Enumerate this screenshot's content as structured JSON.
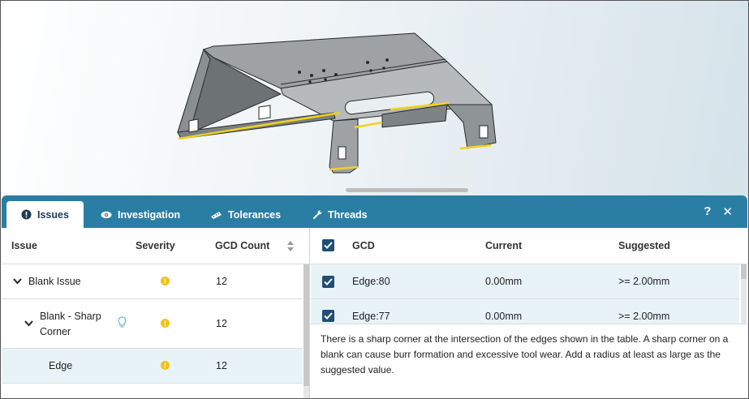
{
  "tabs": [
    {
      "label": "Issues",
      "icon": "info-circle-icon",
      "active": true
    },
    {
      "label": "Investigation",
      "icon": "eye-icon",
      "active": false
    },
    {
      "label": "Tolerances",
      "icon": "ruler-icon",
      "active": false
    },
    {
      "label": "Threads",
      "icon": "wrench-icon",
      "active": false
    }
  ],
  "header_icons": {
    "help": "?",
    "close": "✕"
  },
  "issues_table": {
    "columns": [
      "Issue",
      "Severity",
      "GCD Count"
    ],
    "rows": [
      {
        "label": "Blank Issue",
        "expanded": true,
        "severity": "!",
        "count": "12"
      },
      {
        "label": "Blank - Sharp Corner",
        "expanded": true,
        "severity": "!",
        "count": "12",
        "hint_icon": "lightbulb-icon"
      },
      {
        "label": "Edge",
        "severity": "!",
        "count": "12",
        "selected": true
      }
    ]
  },
  "gcd_table": {
    "columns": [
      "GCD",
      "Current",
      "Suggested"
    ],
    "rows": [
      {
        "gcd": "Edge:80",
        "current": "0.00mm",
        "suggested": ">= 2.00mm",
        "checked": true
      },
      {
        "gcd": "Edge:77",
        "current": "0.00mm",
        "suggested": ">= 2.00mm",
        "checked": true
      }
    ],
    "description": "There is a sharp corner at the intersection of the edges shown in the table. A sharp corner on a blank can cause burr formation and excessive tool wear. Add a radius at least as large as the suggested value."
  },
  "colors": {
    "tab_bar": "#2a7ea4",
    "highlight_edge": "#f2d21a",
    "warning": "#f4c21a",
    "checkbox": "#1f4f74",
    "row_selected": "#e8f3f8"
  }
}
